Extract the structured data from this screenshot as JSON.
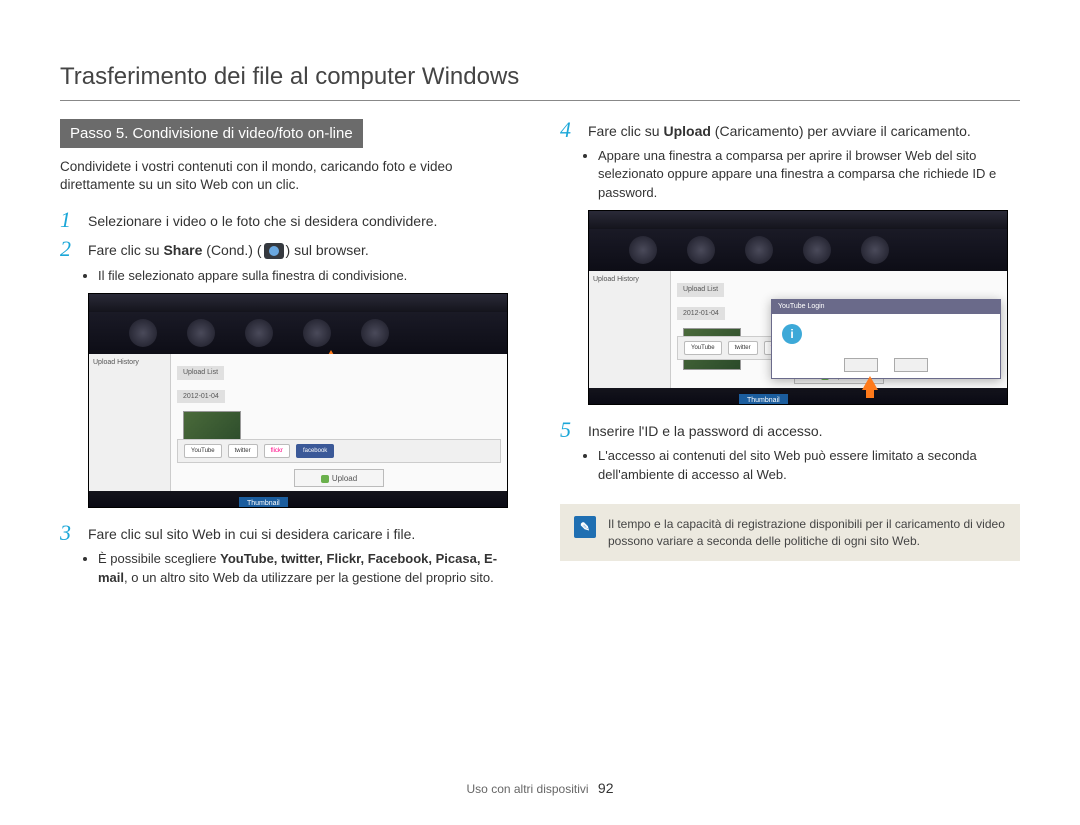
{
  "page_title": "Trasferimento dei file al computer Windows",
  "step_badge": "Passo 5. Condivisione di video/foto on-line",
  "intro": "Condividete i vostri contenuti con il mondo, caricando foto e video direttamente su un sito Web con un clic.",
  "steps": {
    "s1": {
      "num": "1",
      "text": "Selezionare i video o le foto che si desidera condividere."
    },
    "s2": {
      "num": "2",
      "text_before": "Fare clic su ",
      "share_label": "Share",
      "cond_label": " (Cond.) (",
      "after_icon": ") sul browser.",
      "bullet": "Il file selezionato appare sulla finestra di condivisione."
    },
    "s3": {
      "num": "3",
      "text": "Fare clic sul sito Web in cui si desidera caricare i file.",
      "bullet_before": "È possibile scegliere ",
      "sites": "YouTube, twitter, Flickr, Facebook, Picasa, E-mail",
      "bullet_after": ", o un altro sito Web da utilizzare per la gestione del proprio sito."
    },
    "s4": {
      "num": "4",
      "text_before": "Fare clic su ",
      "upload_label": "Upload",
      "text_after": " (Caricamento) per avviare il caricamento.",
      "bullet": "Appare una finestra a comparsa per aprire il browser Web del sito selezionato oppure appare una finestra a comparsa che richiede ID e password."
    },
    "s5": {
      "num": "5",
      "text": "Inserire l'ID e la password di accesso.",
      "bullet": "L'accesso ai contenuti del sito Web può essere limitato a seconda dell'ambiente di accesso al Web."
    }
  },
  "screenshot": {
    "sidebar_title": "Upload History",
    "main_label": "Upload List",
    "date": "2012-01-04",
    "upload_btn": "Upload",
    "popup_title": "YouTube Login",
    "bottom_btn": "Thumbnail",
    "sites": {
      "youtube": "YouTube",
      "twitter": "twitter",
      "flickr": "flickr",
      "facebook": "facebook"
    }
  },
  "note": "Il tempo e la capacità di registrazione disponibili per il caricamento di video possono variare a seconda delle politiche di ogni sito Web.",
  "footer_section": "Uso con altri dispositivi",
  "page_number": "92"
}
